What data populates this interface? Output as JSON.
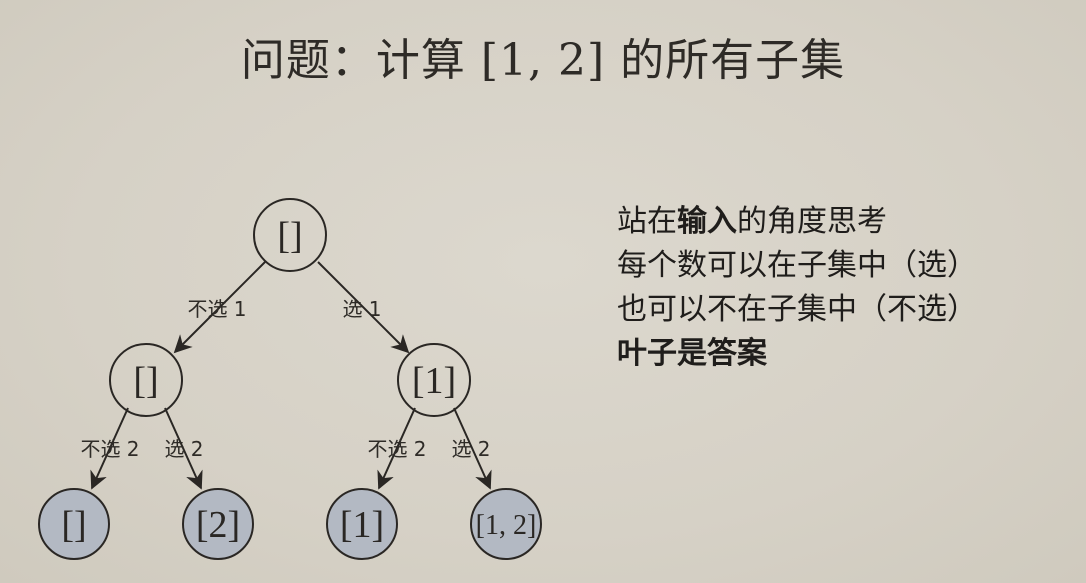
{
  "title": "问题：计算 [1, 2] 的所有子集",
  "tree": {
    "root": {
      "label": "[]"
    },
    "level1": [
      {
        "label": "[]",
        "edge_label": "不选 1"
      },
      {
        "label": "[1]",
        "edge_label": "选 1"
      }
    ],
    "leaves": [
      {
        "label": "[]",
        "edge_label": "不选 2"
      },
      {
        "label": "[2]",
        "edge_label": "选 2"
      },
      {
        "label": "[1]",
        "edge_label": "不选 2"
      },
      {
        "label": "[1, 2]",
        "edge_label": "选 2"
      }
    ]
  },
  "notes": {
    "line1_pre": "站在",
    "line1_bold": "输入",
    "line1_post": "的角度思考",
    "line2": "每个数可以在子集中（选）",
    "line3": "也可以不在子集中（不选）",
    "line4_bold": "叶子是答案"
  },
  "colors": {
    "background": "#d8d3c8",
    "leaf_fill": "#b3b9c3",
    "stroke": "#2a2724"
  }
}
